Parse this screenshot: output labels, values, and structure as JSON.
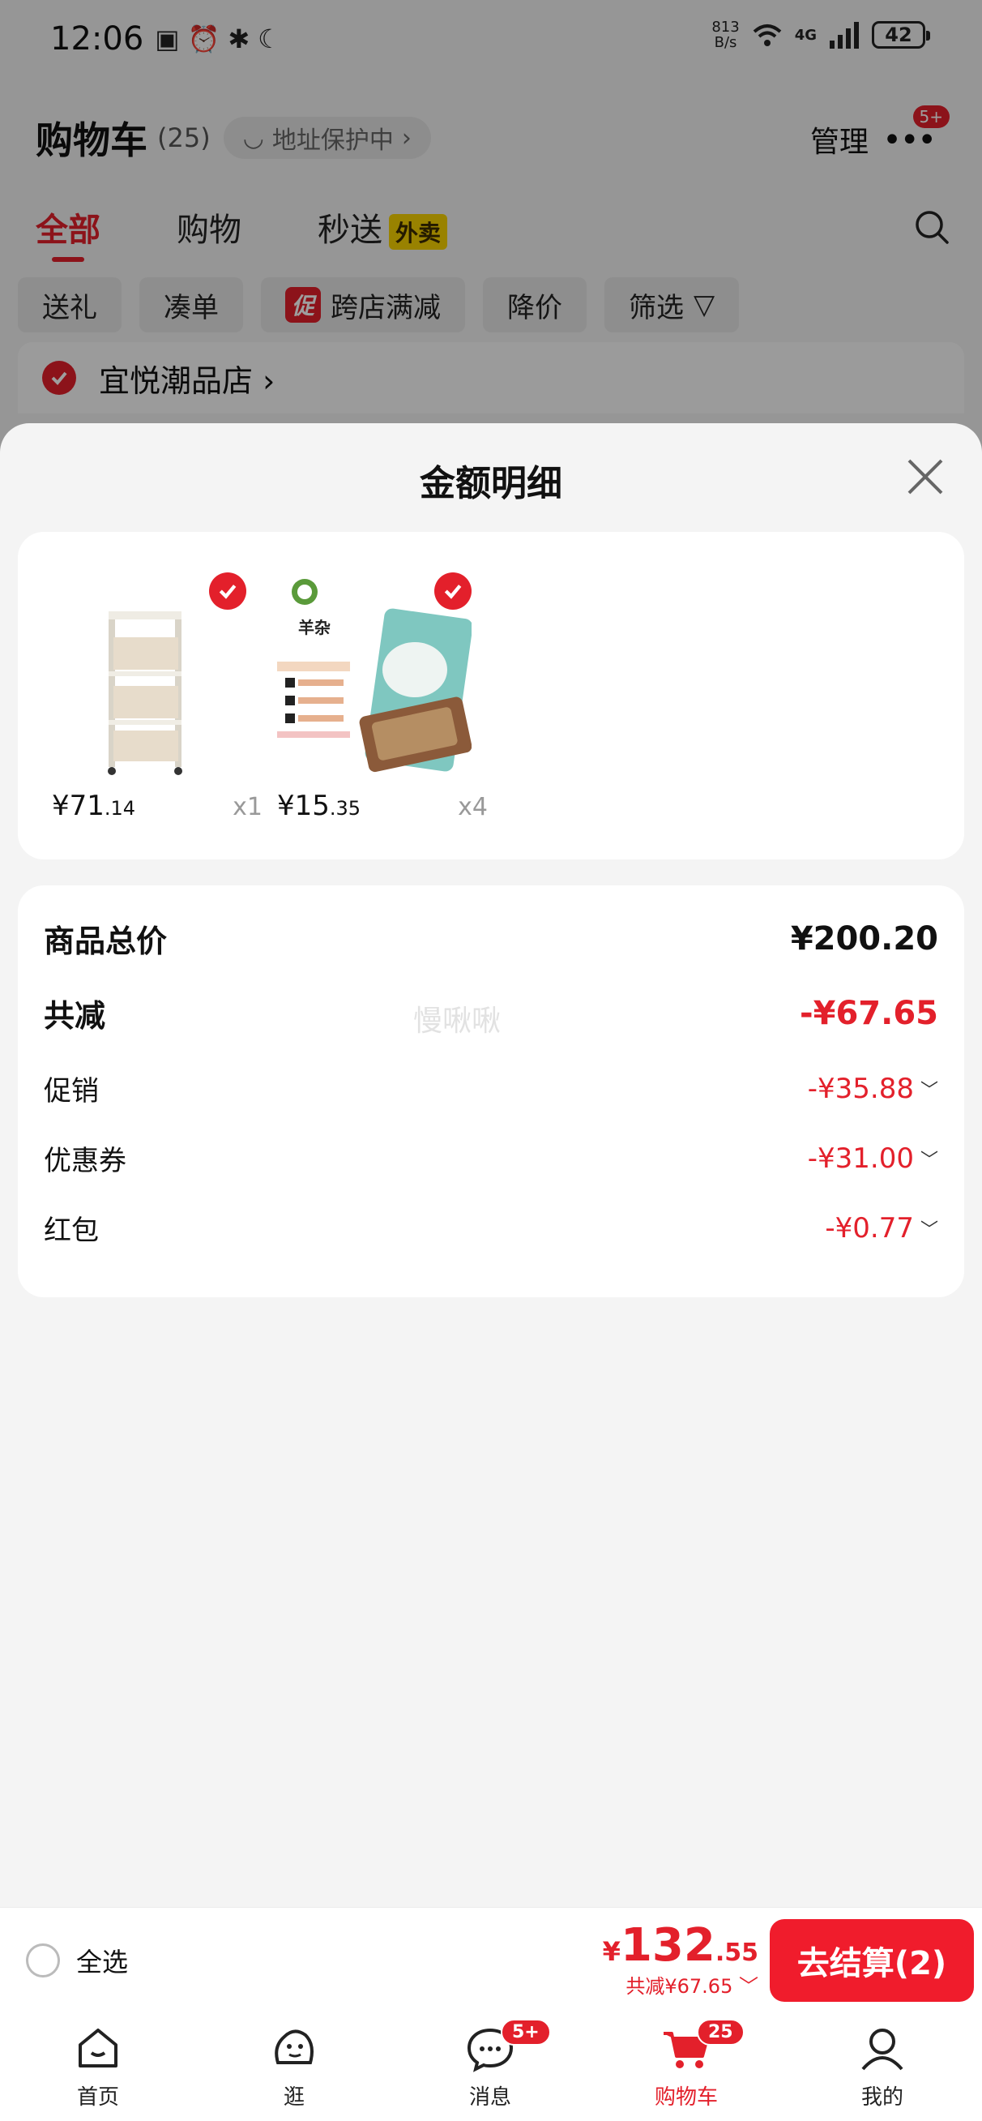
{
  "status_bar": {
    "time": "12:06",
    "net_speed_top": "813",
    "net_speed_bottom": "B/s",
    "network": "4G",
    "battery": "42"
  },
  "header": {
    "title": "购物车",
    "count": "(25)",
    "address_protect": "地址保护中",
    "manage": "管理",
    "more_badge": "5+"
  },
  "tabs": [
    {
      "label": "全部"
    },
    {
      "label": "购物"
    },
    {
      "label": "秒送"
    }
  ],
  "waimai_tag": "外卖",
  "chips": {
    "gift": "送礼",
    "bundle": "凑单",
    "promo_tag": "促",
    "cross_store": "跨店满减",
    "price_drop": "降价",
    "filter": "筛选"
  },
  "shop": {
    "name": "宜悦潮品店"
  },
  "sheet": {
    "title": "金额明细",
    "items": [
      {
        "price_main": "¥71",
        "price_cents": ".14",
        "qty": "x1"
      },
      {
        "price_main": "¥15",
        "price_cents": ".35",
        "qty": "x4"
      }
    ],
    "item2_image_text": "羊杂",
    "summary": {
      "total_label": "商品总价",
      "total_value": "¥200.20",
      "reduce_label": "共减",
      "reduce_value": "-¥67.65",
      "promo_label": "促销",
      "promo_value": "-¥35.88",
      "coupon_label": "优惠券",
      "coupon_value": "-¥31.00",
      "redpacket_label": "红包",
      "redpacket_value": "-¥0.77"
    },
    "watermark": "慢啾啾"
  },
  "checkout": {
    "select_all": "全选",
    "yen": "¥",
    "amount_main": "132",
    "amount_cents": ".55",
    "reduce_text": "共减¥67.65",
    "button": "去结算(2)"
  },
  "bottom_nav": [
    {
      "label": "首页"
    },
    {
      "label": "逛"
    },
    {
      "label": "消息",
      "badge": "5+"
    },
    {
      "label": "购物车",
      "badge": "25"
    },
    {
      "label": "我的"
    }
  ],
  "colors": {
    "accent": "#e3202b",
    "button": "#f01c2c",
    "waimai": "#f7d200"
  }
}
